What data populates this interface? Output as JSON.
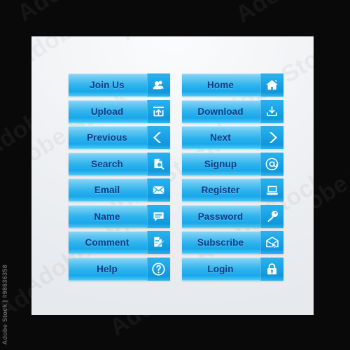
{
  "image": {
    "background_color": "#090909",
    "panel_color": "#eef0f3",
    "accent_color": "#2fb3ee",
    "icon_panel_color": "#1ba3e6",
    "label_color": "#123a86"
  },
  "watermark": {
    "text": "Adobe Stock",
    "id_text": "Adobe Stock | #98636358"
  },
  "buttons": [
    {
      "label": "Join Us",
      "icon": "users-icon",
      "column": "left",
      "row": 1
    },
    {
      "label": "Home",
      "icon": "home-icon",
      "column": "right",
      "row": 1
    },
    {
      "label": "Upload",
      "icon": "upload-icon",
      "column": "left",
      "row": 2
    },
    {
      "label": "Download",
      "icon": "download-icon",
      "column": "right",
      "row": 2
    },
    {
      "label": "Previous",
      "icon": "chevron-left-icon",
      "column": "left",
      "row": 3
    },
    {
      "label": "Next",
      "icon": "chevron-right-icon",
      "column": "right",
      "row": 3
    },
    {
      "label": "Search",
      "icon": "document-search-icon",
      "column": "left",
      "row": 4
    },
    {
      "label": "Signup",
      "icon": "at-sign-icon",
      "column": "right",
      "row": 4
    },
    {
      "label": "Email",
      "icon": "envelope-icon",
      "column": "left",
      "row": 5
    },
    {
      "label": "Register",
      "icon": "laptop-icon",
      "column": "right",
      "row": 5
    },
    {
      "label": "Name",
      "icon": "speech-bubble-icon",
      "column": "left",
      "row": 6
    },
    {
      "label": "Password",
      "icon": "key-icon",
      "column": "right",
      "row": 6
    },
    {
      "label": "Comment",
      "icon": "document-pencil-icon",
      "column": "left",
      "row": 7
    },
    {
      "label": "Subscribe",
      "icon": "envelope-cursor-icon",
      "column": "right",
      "row": 7
    },
    {
      "label": "Help",
      "icon": "question-circle-icon",
      "column": "left",
      "row": 8
    },
    {
      "label": "Login",
      "icon": "padlock-icon",
      "column": "right",
      "row": 8
    }
  ]
}
